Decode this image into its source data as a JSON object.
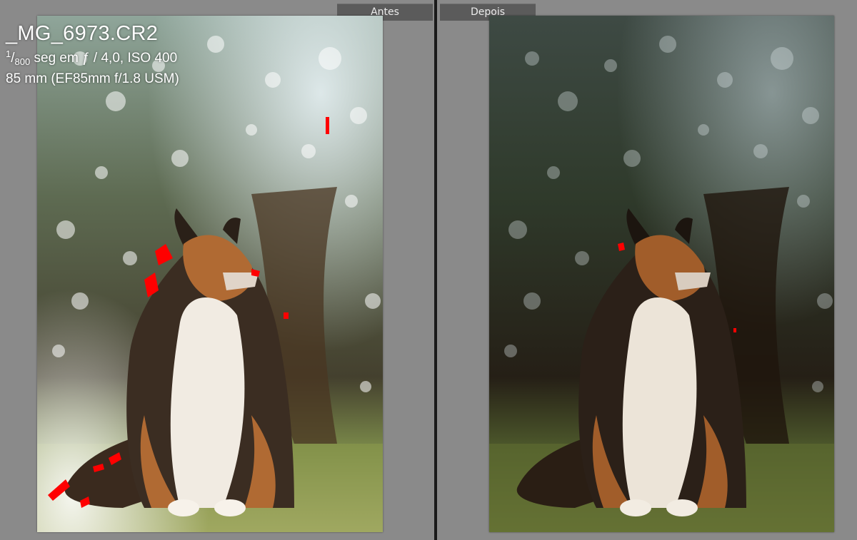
{
  "labels": {
    "before": "Antes",
    "after": "Depois"
  },
  "info": {
    "file_name": "_MG_6973.CR2",
    "shutter_numerator": "1",
    "shutter_denominator": "800",
    "exposure_rest": "seg em ƒ / 4,0, ISO 400",
    "lens": "85 mm (EF85mm f/1.8 USM)"
  },
  "colors": {
    "workspace_bg": "#8a8a8a",
    "label_bg": "#5b5b5b",
    "label_text": "#ececec",
    "divider": "#1a1a1a",
    "clipping_warning": "#ff0000"
  }
}
